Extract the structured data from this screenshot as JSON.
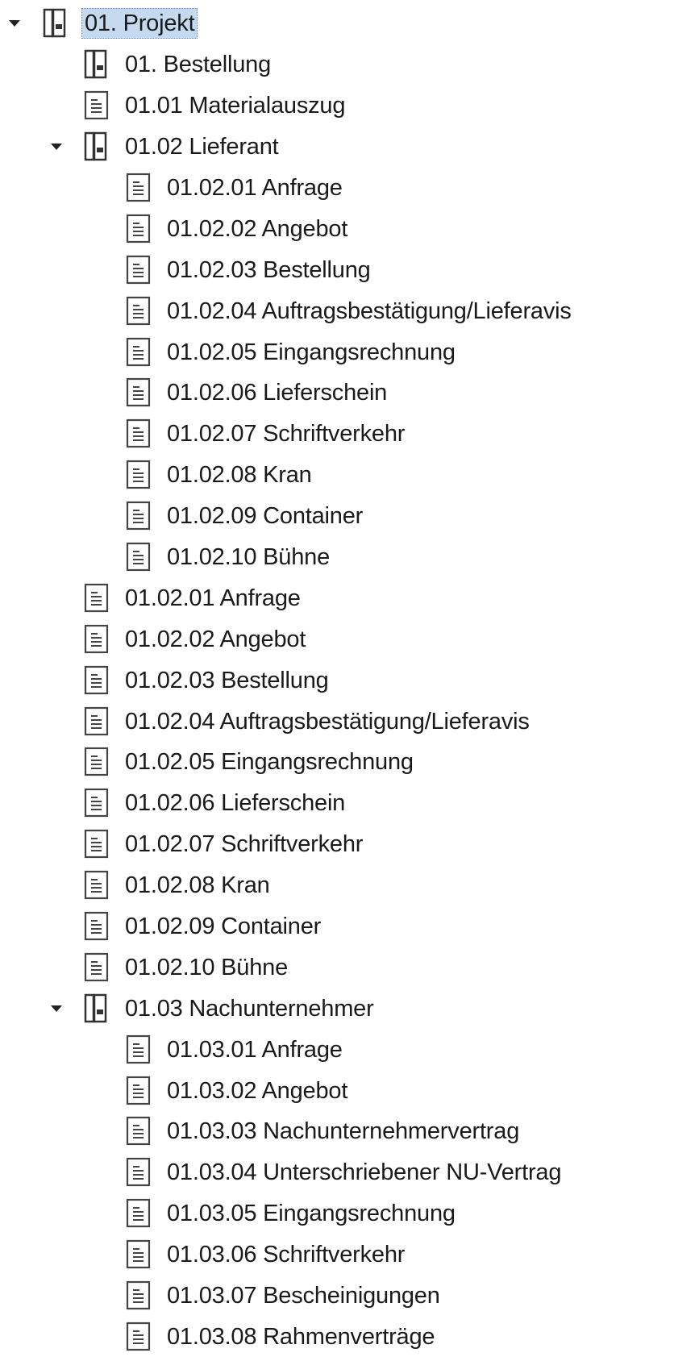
{
  "tree": {
    "root": {
      "label": "01. Projekt",
      "icon": "binder-icon",
      "expanded": true,
      "selected": true
    },
    "level1_a": [
      {
        "label": "01. Bestellung",
        "icon": "binder-icon"
      },
      {
        "label": "01.01 Materialauszug",
        "icon": "document-icon"
      }
    ],
    "lieferant": {
      "label": "01.02 Lieferant",
      "icon": "binder-icon",
      "expanded": true,
      "children": [
        {
          "label": "01.02.01 Anfrage"
        },
        {
          "label": "01.02.02 Angebot"
        },
        {
          "label": "01.02.03 Bestellung"
        },
        {
          "label": "01.02.04 Auftragsbestätigung/Lieferavis"
        },
        {
          "label": "01.02.05 Eingangsrechnung"
        },
        {
          "label": "01.02.06 Lieferschein"
        },
        {
          "label": "01.02.07 Schriftverkehr"
        },
        {
          "label": "01.02.08 Kran"
        },
        {
          "label": "01.02.09 Container"
        },
        {
          "label": "01.02.10 Bühne"
        }
      ]
    },
    "level1_docs": [
      {
        "label": "01.02.01 Anfrage"
      },
      {
        "label": "01.02.02 Angebot"
      },
      {
        "label": "01.02.03 Bestellung"
      },
      {
        "label": "01.02.04 Auftragsbestätigung/Lieferavis"
      },
      {
        "label": "01.02.05 Eingangsrechnung"
      },
      {
        "label": "01.02.06 Lieferschein"
      },
      {
        "label": "01.02.07 Schriftverkehr"
      },
      {
        "label": "01.02.08 Kran"
      },
      {
        "label": "01.02.09 Container"
      },
      {
        "label": "01.02.10 Bühne"
      }
    ],
    "nachunternehmer": {
      "label": "01.03 Nachunternehmer",
      "icon": "binder-icon",
      "expanded": true,
      "children": [
        {
          "label": "01.03.01 Anfrage"
        },
        {
          "label": "01.03.02 Angebot"
        },
        {
          "label": "01.03.03 Nachunternehmervertrag"
        },
        {
          "label": "01.03.04 Unterschriebener NU-Vertrag"
        },
        {
          "label": "01.03.05 Eingangsrechnung"
        },
        {
          "label": "01.03.06 Schriftverkehr"
        },
        {
          "label": "01.03.07 Bescheinigungen"
        },
        {
          "label": "01.03.08 Rahmenverträge"
        }
      ]
    }
  },
  "colors": {
    "selection_bg": "#c5d9ef",
    "selection_border": "#6b8fb8",
    "text": "#1a1a1a",
    "icon_stroke": "#333333"
  }
}
